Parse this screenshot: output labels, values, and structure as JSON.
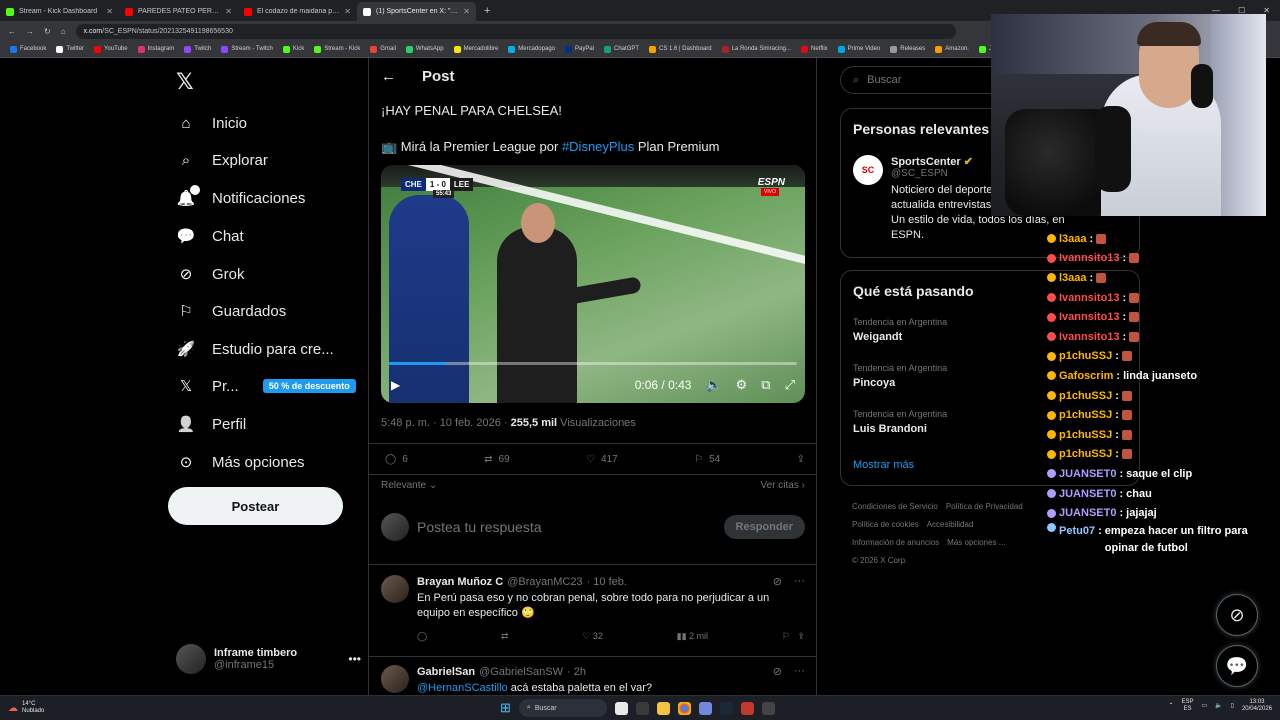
{
  "browser": {
    "tabs": [
      {
        "label": "Stream - Kick Dashboard",
        "color": "#53fc18",
        "active": false
      },
      {
        "label": "PAREDES PATEÓ PERFECTO EL...",
        "color": "#ff0000",
        "active": false
      },
      {
        "label": "El codazo de maidana previo a...",
        "color": "#ff0000",
        "active": false
      },
      {
        "label": "(1) SportsCenter en X: \"¡HAY PE...",
        "color": "#ffffff",
        "active": true
      }
    ],
    "url_host": "x.com",
    "url_path": "/SC_ESPN/status/2021325491198656530",
    "bookmarks": [
      {
        "label": "Facebook",
        "color": "#1877f2"
      },
      {
        "label": "Twitter",
        "color": "#ffffff"
      },
      {
        "label": "YouTube",
        "color": "#ff0000"
      },
      {
        "label": "Instagram",
        "color": "#e1306c"
      },
      {
        "label": "Twitch",
        "color": "#9146ff"
      },
      {
        "label": "Stream - Twitch",
        "color": "#9146ff"
      },
      {
        "label": "Kick",
        "color": "#53fc18"
      },
      {
        "label": "Stream - Kick",
        "color": "#53fc18"
      },
      {
        "label": "Gmail",
        "color": "#ea4335"
      },
      {
        "label": "WhatsApp",
        "color": "#25d366"
      },
      {
        "label": "Mercadolibre",
        "color": "#ffe600"
      },
      {
        "label": "Mercadopago",
        "color": "#00b1ea"
      },
      {
        "label": "PayPal",
        "color": "#003087"
      },
      {
        "label": "ChatGPT",
        "color": "#10a37f"
      },
      {
        "label": "CS 1.6 | Dashboard",
        "color": "#f4a300"
      },
      {
        "label": "La Ronda Simracing...",
        "color": "#aa2222"
      },
      {
        "label": "Netflix",
        "color": "#e50914"
      },
      {
        "label": "Prime Video",
        "color": "#00a8e1"
      },
      {
        "label": "Releases",
        "color": "#999999"
      },
      {
        "label": "Amazon.",
        "color": "#ff9900"
      },
      {
        "label": "JUAN",
        "color": "#53fc18"
      }
    ]
  },
  "nav": {
    "items": [
      {
        "label": "Inicio",
        "icon": "home-icon"
      },
      {
        "label": "Explorar",
        "icon": "search-icon"
      },
      {
        "label": "Notificaciones",
        "icon": "bell-icon",
        "badge": "1"
      },
      {
        "label": "Chat",
        "icon": "chat-icon"
      },
      {
        "label": "Grok",
        "icon": "grok-icon"
      },
      {
        "label": "Guardados",
        "icon": "bookmark-icon"
      },
      {
        "label": "Estudio para cre...",
        "icon": "rocket-icon"
      },
      {
        "label": "Pr...",
        "icon": "x-icon",
        "promo": "50 % de descuento"
      },
      {
        "label": "Perfil",
        "icon": "person-icon"
      },
      {
        "label": "Más opciones",
        "icon": "more-circle-icon"
      }
    ],
    "post_button": "Postear",
    "account": {
      "name": "Inframe timbero",
      "handle": "@inframe15"
    }
  },
  "post": {
    "header": "Post",
    "line1": "¡HAY PENAL PARA CHELSEA!",
    "line2_prefix": "📺 Mirá la Premier League por ",
    "hashtag": "#DisneyPlus",
    "line2_suffix": " Plan Premium",
    "video": {
      "home": "CHE",
      "score": "1 - 0",
      "away": "LEE",
      "clock": "55:43",
      "brand": "ESPN",
      "live": "VIVO",
      "time": "0:06 / 0:43",
      "progress": 0.14
    },
    "timestamp": "5:48 p. m. · 10 feb. 2026 · ",
    "views": "255,5 mil",
    "views_label": " Visualizaciones",
    "stats": {
      "replies": "6",
      "reposts": "69",
      "likes": "417",
      "bookmarks": "54"
    },
    "sort_label": "Relevante",
    "quotes_label": "Ver citas",
    "reply_placeholder": "Postea tu respuesta",
    "reply_button": "Responder"
  },
  "replies": [
    {
      "name": "Brayan Muñoz C",
      "handle": "@BrayanMC23",
      "time": "· 10 feb.",
      "text": "En Perú pasa eso y no cobran penal, sobre todo para no perjudicar a un equipo en específico 🙄",
      "likes": "32",
      "views": "2 mil"
    },
    {
      "name": "GabrielSan",
      "handle": "@GabrielSanSW",
      "time": "· 2h",
      "mention": "@HernanSCastillo",
      "text": " acá estaba paletta en el var?"
    }
  ],
  "right": {
    "search_placeholder": "Buscar",
    "relevant_title": "Personas relevantes",
    "sc_name": "SportsCenter",
    "sc_handle": "@SC_ESPN",
    "sc_bio": "Noticiero del deporte de toda la actualida entrevistas, destacados. Un estilo de vida, todos los días, en ESPN.",
    "trending_title": "Qué está pasando",
    "trends": [
      {
        "category": "Tendencia en Argentina",
        "name": "Weigandt"
      },
      {
        "category": "Tendencia en Argentina",
        "name": "Pincoya"
      },
      {
        "category": "Tendencia en Argentina",
        "name": "Luis Brandoni"
      }
    ],
    "show_more": "Mostrar más",
    "footer": [
      "Condiciones de Servicio",
      "Política de Privacidad",
      "Política de cookies",
      "Accesibilidad",
      "Información de anuncios",
      "Más opciones ...",
      "© 2026 X Corp."
    ]
  },
  "chat": [
    {
      "user": "l3aaa",
      "color": "#ffb700",
      "emote": true,
      "text": ""
    },
    {
      "user": "Ivannsito13",
      "color": "#ff4d4d",
      "emote": true,
      "text": ""
    },
    {
      "user": "l3aaa",
      "color": "#ffb700",
      "emote": true,
      "text": ""
    },
    {
      "user": "Ivannsito13",
      "color": "#ff4d4d",
      "emote": true,
      "text": ""
    },
    {
      "user": "Ivannsito13",
      "color": "#ff4d4d",
      "emote": true,
      "text": ""
    },
    {
      "user": "Ivannsito13",
      "color": "#ff4d4d",
      "emote": true,
      "text": ""
    },
    {
      "user": "p1chuSSJ",
      "color": "#ffb700",
      "emote": true,
      "text": ""
    },
    {
      "user": "Gafoscrim",
      "color": "#ffb700",
      "emote": false,
      "text": "linda juanseto"
    },
    {
      "user": "p1chuSSJ",
      "color": "#ffb700",
      "emote": true,
      "text": ""
    },
    {
      "user": "p1chuSSJ",
      "color": "#ffb700",
      "emote": true,
      "text": ""
    },
    {
      "user": "p1chuSSJ",
      "color": "#ffb700",
      "emote": true,
      "text": ""
    },
    {
      "user": "p1chuSSJ",
      "color": "#ffb700",
      "emote": true,
      "text": ""
    },
    {
      "user": "JUANSET0",
      "color": "#b19cff",
      "emote": false,
      "text": "saque el clip"
    },
    {
      "user": "JUANSET0",
      "color": "#b19cff",
      "emote": false,
      "text": "chau"
    },
    {
      "user": "JUANSET0",
      "color": "#b19cff",
      "emote": false,
      "text": "jajajaj"
    },
    {
      "user": "Petu07",
      "color": "#8ec8ff",
      "emote": false,
      "text": "empeza hacer un filtro para opinar de futbol"
    }
  ],
  "taskbar": {
    "temp": "14°C",
    "weather": "Nublado",
    "search": "Buscar",
    "lang": "ESP",
    "region": "ES",
    "time": "13:03",
    "date": "20/04/2026"
  },
  "colors": {
    "accent": "#1d9bf0",
    "background": "#000000",
    "border": "#2f3336",
    "muted": "#71767b"
  }
}
